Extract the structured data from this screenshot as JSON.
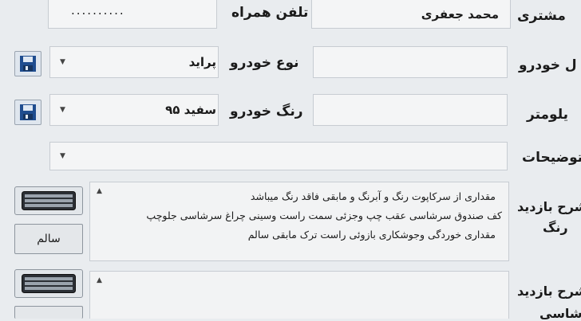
{
  "header": {
    "customer_label": "مشتری",
    "customer_value": "محمد جعفری",
    "mobile_label": "تلفن همراه",
    "mobile_value": ".........."
  },
  "vehicle": {
    "section_label": "ل خودرو",
    "type_label": "نوع خودرو",
    "type_value": "پراید",
    "color_label": "رنگ خودرو",
    "color_value": "سفید ۹۵",
    "odometer_label": "یلومتر"
  },
  "description": {
    "label": "توضیحات"
  },
  "paint_inspection": {
    "label_line1": "شرح بازدید",
    "label_line2": "رنگ",
    "notes": [
      "مقداری از سرکاپوت رنگ و آبرنگ و مابقی فاقد رنگ میباشد",
      "کف صندوق سرشاسی عقب چپ وجزئی سمت راست وسینی چراغ سرشاسی جلوچپ",
      "مقداری خوردگی وجوشکاری بازوئی راست ترک مابقی سالم"
    ],
    "status_button_label": "سالم"
  },
  "second_inspection": {
    "label_line1": "شرح بازدید",
    "label_line2": "شاسی"
  }
}
